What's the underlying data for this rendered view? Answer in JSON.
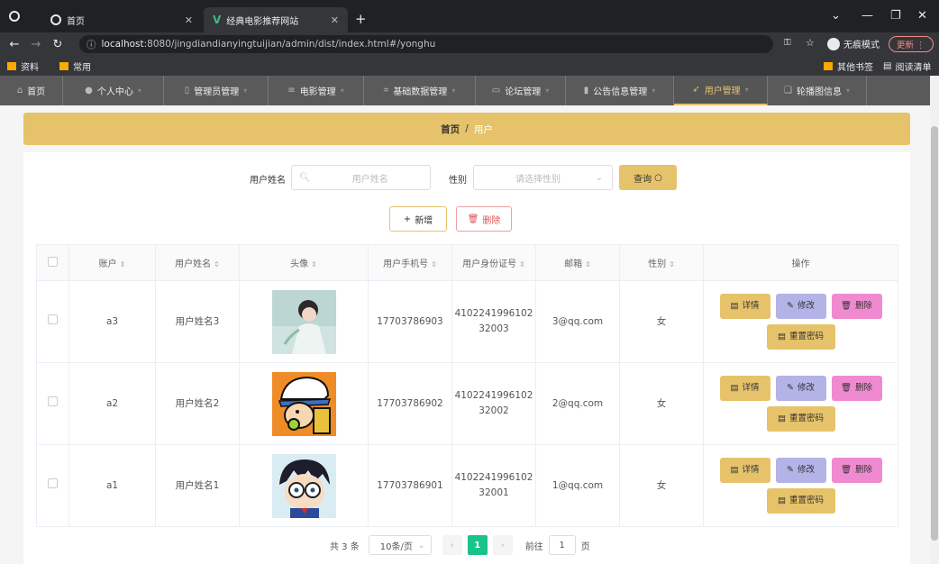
{
  "browser": {
    "tabs": [
      {
        "title": "首页"
      },
      {
        "title": "经典电影推荐网站"
      }
    ],
    "url_host": "localhost",
    "url_rest": ":8080/jingdiandianyingtuijian/admin/dist/index.html#/yonghu",
    "incognito_label": "无痕模式",
    "update_label": "更新",
    "bookmarks": [
      "资料",
      "常用"
    ],
    "other_bookmarks": "其他书签",
    "reading_list": "阅读清单"
  },
  "nav": {
    "items": [
      {
        "label": "首页",
        "icon": "home-icon"
      },
      {
        "label": "个人中心",
        "icon": "user-icon"
      },
      {
        "label": "管理员管理",
        "icon": "admin-icon"
      },
      {
        "label": "电影管理",
        "icon": "list-icon"
      },
      {
        "label": "基础数据管理",
        "icon": "crop-icon"
      },
      {
        "label": "论坛管理",
        "icon": "forum-icon"
      },
      {
        "label": "公告信息管理",
        "icon": "chart-icon"
      },
      {
        "label": "用户管理",
        "icon": "send-icon"
      },
      {
        "label": "轮播图信息",
        "icon": "copy-icon"
      }
    ]
  },
  "breadcrumb": {
    "home": "首页",
    "separator": "/",
    "current": "用户"
  },
  "search": {
    "name_label": "用户姓名",
    "name_placeholder": "用户姓名",
    "gender_label": "性别",
    "gender_placeholder": "请选择性别",
    "query_button": "查询"
  },
  "actions": {
    "add": "新增",
    "delete": "删除"
  },
  "table": {
    "headers": [
      "账户",
      "用户姓名",
      "头像",
      "用户手机号",
      "用户身份证号",
      "邮箱",
      "性别",
      "操作"
    ],
    "rows": [
      {
        "account": "a3",
        "name": "用户姓名3",
        "phone": "17703786903",
        "id_line1": "4102241996102",
        "id_line2": "32003",
        "email": "3@qq.com",
        "gender": "女"
      },
      {
        "account": "a2",
        "name": "用户姓名2",
        "phone": "17703786902",
        "id_line1": "4102241996102",
        "id_line2": "32002",
        "email": "2@qq.com",
        "gender": "女"
      },
      {
        "account": "a1",
        "name": "用户姓名1",
        "phone": "17703786901",
        "id_line1": "4102241996102",
        "id_line2": "32001",
        "email": "1@qq.com",
        "gender": "女"
      }
    ],
    "row_buttons": {
      "detail": "详情",
      "edit": "修改",
      "delete": "删除",
      "reset": "重置密码"
    }
  },
  "pager": {
    "total": "共 3 条",
    "page_size": "10条/页",
    "current_page": "1",
    "goto_prefix": "前往",
    "goto_value": "1",
    "goto_suffix": "页"
  },
  "colors": {
    "accent": "#e6c36a",
    "edit": "#b3b3e8",
    "danger": "#f08ad0",
    "page_active": "#19c38a"
  }
}
